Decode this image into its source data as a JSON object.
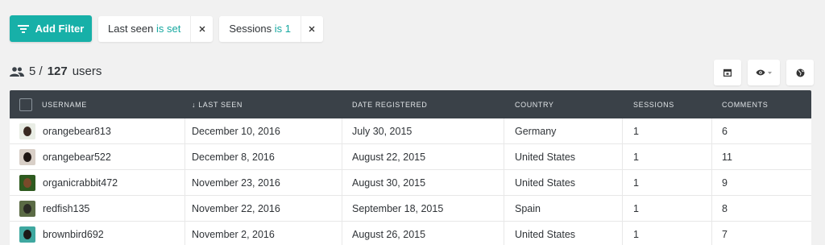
{
  "filters": {
    "add_label": "Add Filter",
    "chips": [
      {
        "field": "Last seen",
        "operator": "is set"
      },
      {
        "field": "Sessions",
        "operator": "is 1"
      }
    ]
  },
  "summary": {
    "shown": "5 /",
    "total": "127",
    "noun": "users"
  },
  "colors": {
    "accent": "#17b0a8",
    "header_bg": "#3a4148"
  },
  "table": {
    "columns": [
      "USERNAME",
      "↓ LAST SEEN",
      "DATE REGISTERED",
      "COUNTRY",
      "SESSIONS",
      "COMMENTS"
    ],
    "rows": [
      {
        "username": "orangebear813",
        "last_seen": "December 10, 2016",
        "registered": "July 30, 2015",
        "country": "Germany",
        "sessions": "1",
        "comments": "6"
      },
      {
        "username": "orangebear522",
        "last_seen": "December 8, 2016",
        "registered": "August 22, 2015",
        "country": "United States",
        "sessions": "1",
        "comments": "11"
      },
      {
        "username": "organicrabbit472",
        "last_seen": "November 23, 2016",
        "registered": "August 30, 2015",
        "country": "United States",
        "sessions": "1",
        "comments": "9"
      },
      {
        "username": "redfish135",
        "last_seen": "November 22, 2016",
        "registered": "September 18, 2015",
        "country": "Spain",
        "sessions": "1",
        "comments": "8"
      },
      {
        "username": "brownbird692",
        "last_seen": "November 2, 2016",
        "registered": "August 26, 2015",
        "country": "United States",
        "sessions": "1",
        "comments": "7"
      }
    ]
  }
}
